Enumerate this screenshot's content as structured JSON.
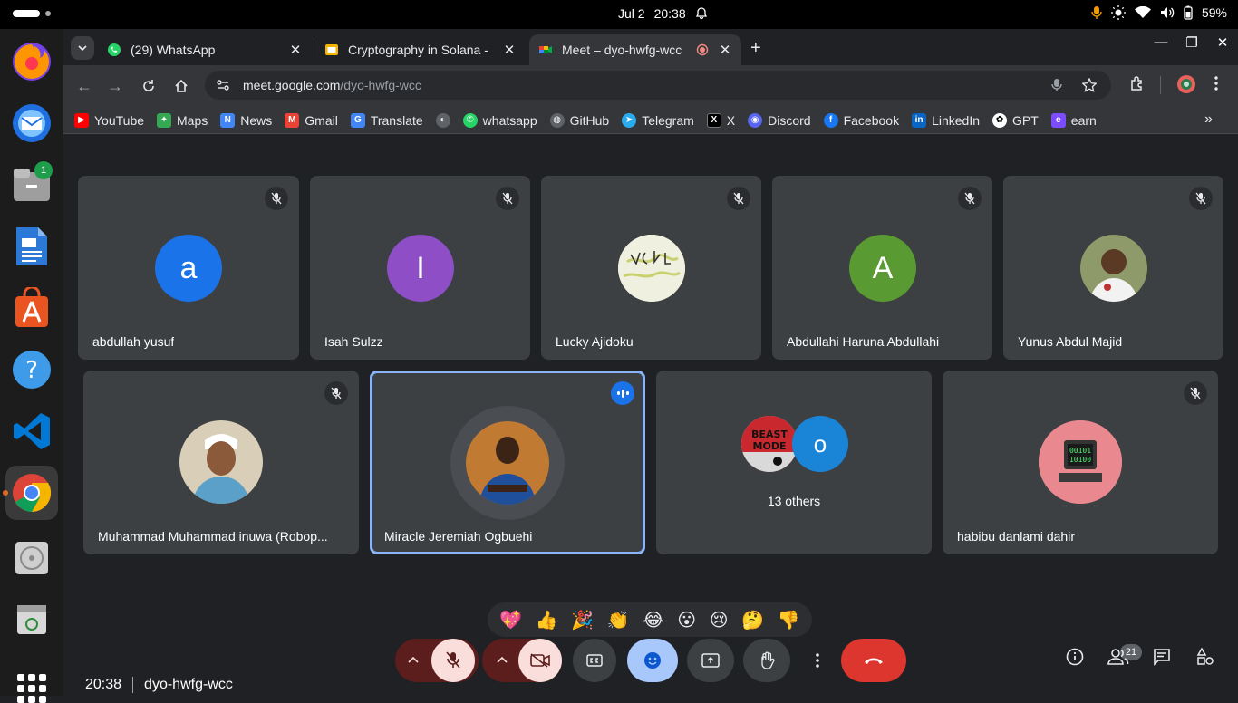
{
  "system": {
    "date": "Jul 2",
    "time": "20:38",
    "battery": "59%"
  },
  "browser": {
    "tabs": [
      {
        "title": "(29) WhatsApp",
        "favicon": "whatsapp-icon"
      },
      {
        "title": "Cryptography in Solana -",
        "favicon": "slides-icon"
      },
      {
        "title": "Meet – dyo-hwfg-wcc",
        "favicon": "meet-icon"
      }
    ],
    "url_host": "meet.google.com",
    "url_path": "/dyo-hwfg-wcc",
    "bookmarks": [
      {
        "label": "YouTube",
        "color": "#ff0000"
      },
      {
        "label": "Maps",
        "color": "#34a853"
      },
      {
        "label": "News",
        "color": "#4285f4"
      },
      {
        "label": "Gmail",
        "color": "#ea4335"
      },
      {
        "label": "Translate",
        "color": "#4285f4"
      },
      {
        "label": "",
        "color": "#9aa0a6"
      },
      {
        "label": "whatsapp",
        "color": "#25d366"
      },
      {
        "label": "GitHub",
        "color": "#e8eaed"
      },
      {
        "label": "Telegram",
        "color": "#2aabee"
      },
      {
        "label": "X",
        "color": "#000000"
      },
      {
        "label": "Discord",
        "color": "#5865f2"
      },
      {
        "label": "Facebook",
        "color": "#1877f2"
      },
      {
        "label": "LinkedIn",
        "color": "#0a66c2"
      },
      {
        "label": "GPT",
        "color": "#ffffff"
      },
      {
        "label": "earn",
        "color": "#7c4dff"
      }
    ]
  },
  "meet": {
    "row1": [
      {
        "name": "abdullah yusuf",
        "initial": "a",
        "color": "#1a73e8"
      },
      {
        "name": "Isah Sulzz",
        "initial": "I",
        "color": "#8e4ec6"
      },
      {
        "name": "Lucky Ajidoku",
        "initial": "",
        "color": "#e8e8d0"
      },
      {
        "name": "Abdullahi Haruna Abdullahi",
        "initial": "A",
        "color": "#5a9a32"
      },
      {
        "name": "Yunus Abdul Majid",
        "initial": "",
        "color": "#7a6a4a"
      }
    ],
    "row2": [
      {
        "name": "Muhammad Muhammad inuwa (Robop...",
        "initial": "",
        "color": "#c9b89a"
      },
      {
        "name": "Miracle Jeremiah Ogbuehi",
        "initial": "",
        "color": "#b8702a"
      },
      {
        "name": "13 others",
        "initial": "o",
        "color": "#1a85d6"
      },
      {
        "name": "habibu danlami dahir",
        "initial": "",
        "color": "#e8868e"
      }
    ],
    "others_avatar_text": "BEAST MODE",
    "reactions": [
      "💖",
      "👍",
      "🎉",
      "👏",
      "😂",
      "😮",
      "😢",
      "🤔",
      "👎"
    ],
    "meeting_time": "20:38",
    "meeting_code": "dyo-hwfg-wcc",
    "participant_count": "21"
  }
}
